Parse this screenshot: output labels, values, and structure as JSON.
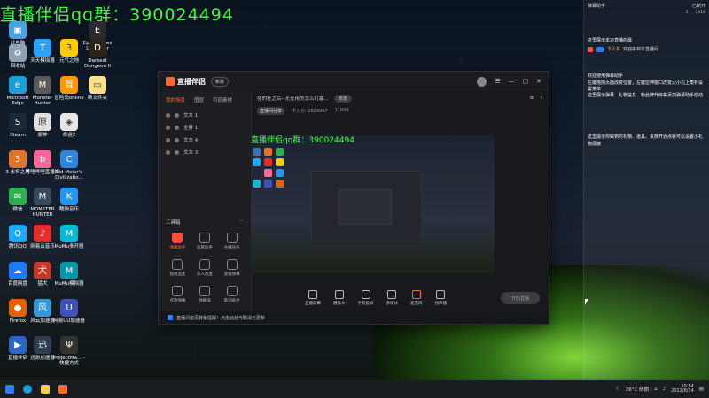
{
  "overlay": {
    "title": "直播伴侣qq群：390024494"
  },
  "desktop_icons": [
    {
      "label": "此电脑",
      "color": "#4aa3df"
    },
    {
      "label": "回收站",
      "color": "#8fa3b8"
    },
    {
      "label": "Microsoft Edge",
      "color": "#1c9fd9"
    },
    {
      "label": "Steam",
      "color": "#1b2838"
    },
    {
      "label": "3 永恒之塔",
      "color": "#e2742c"
    },
    {
      "label": "微信",
      "color": "#2bb24c"
    },
    {
      "label": "腾讯QQ",
      "color": "#1ea8ff"
    },
    {
      "label": "百度网盘",
      "color": "#1d7bff"
    },
    {
      "label": "Firefox",
      "color": "#e66000"
    },
    {
      "label": "直播伴侣",
      "color": "#2b66c5"
    },
    {
      "label": "Epic Games Launcher",
      "color": "#2b2b2b"
    },
    {
      "label": "天天模拟器",
      "color": "#2aa0ff"
    },
    {
      "label": "Monster Hunter",
      "color": "#5a5a5a"
    },
    {
      "label": "原神",
      "color": "#e0e0e0"
    },
    {
      "label": "哔哩哔哩直播姬",
      "color": "#ff6699"
    },
    {
      "label": "MONSTER HUNTER",
      "color": "#34495e"
    },
    {
      "label": "网易云音乐",
      "color": "#e72d2c"
    },
    {
      "label": "猛犬",
      "color": "#c0392b"
    },
    {
      "label": "风云加速器",
      "color": "#3498db"
    },
    {
      "label": "迅游加速器",
      "color": "#2c3e50"
    },
    {
      "label": "元气之地",
      "color": "#ffcc00"
    },
    {
      "label": "Darkest Dungeon II",
      "color": "#2d2418"
    },
    {
      "label": "冒险岛online",
      "color": "#ff9800"
    },
    {
      "label": "新文件夹",
      "color": "#ffe08a"
    },
    {
      "label": "命运2",
      "color": "#e6e6e6"
    },
    {
      "label": "Sid Meier's Civilizatio...",
      "color": "#2e86de"
    },
    {
      "label": "酷狗音乐",
      "color": "#2196f3"
    },
    {
      "label": "MuMu多开器",
      "color": "#00bcd4"
    },
    {
      "label": "MuMu模拟器",
      "color": "#0097a7"
    },
    {
      "label": "网易UU加速器",
      "color": "#3f51b5"
    },
    {
      "label": "ProjectMa... - 快捷方式",
      "color": "#333333"
    }
  ],
  "app": {
    "name": "直播伴侣",
    "version": "新版",
    "side_tabs": [
      "我的场景",
      "图层",
      "可调素材"
    ],
    "layers": [
      "文本 1",
      "全屏 1",
      "文本 4",
      "文本 3"
    ],
    "tools_title": "工具箱",
    "tools": [
      "弹幕助手",
      "房管助手",
      "主播任务",
      "视频连麦",
      "多人连麦",
      "滤镜弹幕",
      "点歌弹幕",
      "弹幕墙",
      "歌词助手"
    ],
    "room_title": "在的狂之后--无光用的怎么打赢...",
    "room_tag": "修改",
    "sub_items": [
      "直播间分享",
      "下入分: 2829997",
      "11609"
    ],
    "bottom_tools": [
      "直播屏幕",
      "摄像头",
      "手机投屏",
      "多媒体",
      "麦克风",
      "扬声器"
    ],
    "go_live": "开始直播",
    "notice": "直播间首页背景提醒！点击此处可取消与更新"
  },
  "chat": {
    "header": "弹幕助手",
    "header_right": "已断开",
    "stats": [
      "2",
      "3418"
    ],
    "msg1": "这里展示本次直播的最",
    "user_badge": "下人东",
    "user_text": "欢迎来到本直播间",
    "msg2": "欢迎使用弹幕助手",
    "msg3": "左键拖拽页面改变位置，左键拉伸窗口改变大小右上角有设置菜单",
    "msg4": "这里展示弹幕、礼物信息、粉丝牌升级等添加弹幕助手感动",
    "msg5": "这里展示你收到的礼物、道具、贵族开通点就可以设置小礼物屏蔽"
  },
  "taskbar": {
    "weather": "26°C 晴朗",
    "time": "20:54",
    "date": "2022/6/14"
  }
}
